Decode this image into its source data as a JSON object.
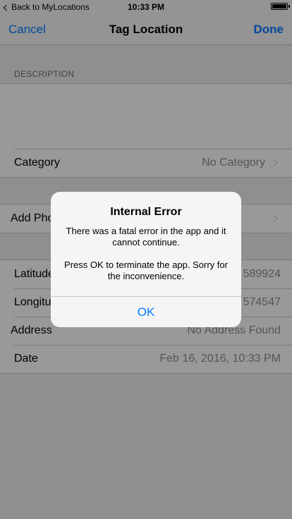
{
  "status_bar": {
    "back_label": "Back to MyLocations",
    "time": "10:33 PM",
    "battery_level": 1.0
  },
  "nav": {
    "cancel": "Cancel",
    "title": "Tag Location",
    "done": "Done"
  },
  "description_section": {
    "header": "DESCRIPTION",
    "text": ""
  },
  "category": {
    "label": "Category",
    "value": "No Category"
  },
  "photo": {
    "label": "Add Photo"
  },
  "location": {
    "latitude_label": "Latitude",
    "latitude_value": "589924",
    "longitude_label": "Longitude",
    "longitude_value": "574547",
    "address_label": "Address",
    "address_value": "No Address Found",
    "date_label": "Date",
    "date_value": "Feb 16, 2016, 10:33 PM"
  },
  "alert": {
    "title": "Internal Error",
    "message_line1": "There was a fatal error in the app and it cannot continue.",
    "message_line2": "Press OK to terminate the app. Sorry for the inconvenience.",
    "ok_label": "OK"
  },
  "colors": {
    "tint": "#007aff",
    "background": "#efeff4",
    "secondary_text": "#8e8e93"
  },
  "icons": {
    "back": "chevron-left-icon",
    "disclosure": "chevron-right-icon",
    "battery": "battery-icon"
  }
}
